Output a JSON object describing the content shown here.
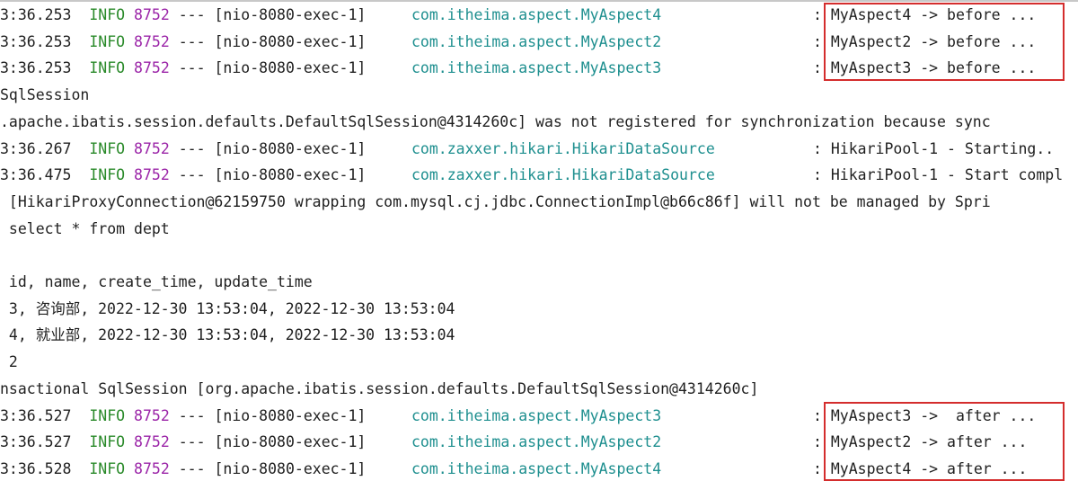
{
  "log_lines": [
    {
      "kind": "log",
      "ts": "3:36.253",
      "level": "INFO",
      "pid": "8752",
      "sep": "---",
      "thread": "[nio-8080-exec-1]",
      "logger": "com.itheima.aspect.MyAspect4",
      "colon": ":",
      "message": "MyAspect4 -> before ..."
    },
    {
      "kind": "log",
      "ts": "3:36.253",
      "level": "INFO",
      "pid": "8752",
      "sep": "---",
      "thread": "[nio-8080-exec-1]",
      "logger": "com.itheima.aspect.MyAspect2",
      "colon": ":",
      "message": "MyAspect2 -> before ..."
    },
    {
      "kind": "log",
      "ts": "3:36.253",
      "level": "INFO",
      "pid": "8752",
      "sep": "---",
      "thread": "[nio-8080-exec-1]",
      "logger": "com.itheima.aspect.MyAspect3",
      "colon": ":",
      "message": "MyAspect3 -> before ..."
    },
    {
      "kind": "text",
      "text": "SqlSession"
    },
    {
      "kind": "text",
      "text": ".apache.ibatis.session.defaults.DefaultSqlSession@4314260c] was not registered for synchronization because sync"
    },
    {
      "kind": "log",
      "ts": "3:36.267",
      "level": "INFO",
      "pid": "8752",
      "sep": "---",
      "thread": "[nio-8080-exec-1]",
      "logger": "com.zaxxer.hikari.HikariDataSource",
      "colon": ":",
      "message": "HikariPool-1 - Starting.."
    },
    {
      "kind": "log",
      "ts": "3:36.475",
      "level": "INFO",
      "pid": "8752",
      "sep": "---",
      "thread": "[nio-8080-exec-1]",
      "logger": "com.zaxxer.hikari.HikariDataSource",
      "colon": ":",
      "message": "HikariPool-1 - Start compl"
    },
    {
      "kind": "text",
      "text": " [HikariProxyConnection@62159750 wrapping com.mysql.cj.jdbc.ConnectionImpl@b66c86f] will not be managed by Spri"
    },
    {
      "kind": "text",
      "text": " select * from dept"
    },
    {
      "kind": "text",
      "text": ""
    },
    {
      "kind": "text",
      "text": " id, name, create_time, update_time"
    },
    {
      "kind": "text",
      "text": " 3, 咨询部, 2022-12-30 13:53:04, 2022-12-30 13:53:04"
    },
    {
      "kind": "text",
      "text": " 4, 就业部, 2022-12-30 13:53:04, 2022-12-30 13:53:04"
    },
    {
      "kind": "text",
      "text": " 2"
    },
    {
      "kind": "text",
      "text": "nsactional SqlSession [org.apache.ibatis.session.defaults.DefaultSqlSession@4314260c]"
    },
    {
      "kind": "log",
      "ts": "3:36.527",
      "level": "INFO",
      "pid": "8752",
      "sep": "---",
      "thread": "[nio-8080-exec-1]",
      "logger": "com.itheima.aspect.MyAspect3",
      "colon": ":",
      "message": "MyAspect3 ->  after ..."
    },
    {
      "kind": "log",
      "ts": "3:36.527",
      "level": "INFO",
      "pid": "8752",
      "sep": "---",
      "thread": "[nio-8080-exec-1]",
      "logger": "com.itheima.aspect.MyAspect2",
      "colon": ":",
      "message": "MyAspect2 -> after ..."
    },
    {
      "kind": "log",
      "ts": "3:36.528",
      "level": "INFO",
      "pid": "8752",
      "sep": "---",
      "thread": "[nio-8080-exec-1]",
      "logger": "com.itheima.aspect.MyAspect4",
      "colon": ":",
      "message": "MyAspect4 -> after ..."
    }
  ],
  "colors": {
    "level": "#2a8a2a",
    "pid": "#9b25a8",
    "logger": "#1e8f8f",
    "highlight_border": "#d42d2d"
  }
}
